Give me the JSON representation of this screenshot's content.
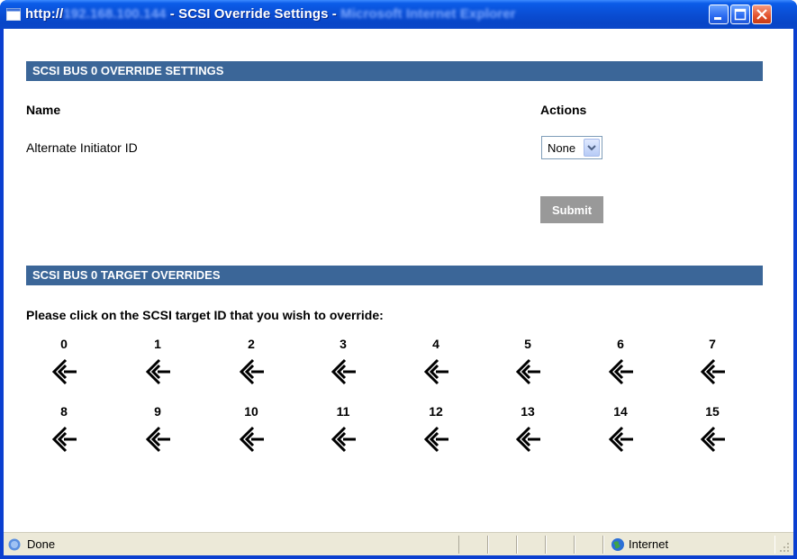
{
  "window": {
    "title_prefix": "http://",
    "title_host": "192.168.100.144",
    "title_middle": " - SCSI Override Settings - ",
    "title_browser": "Microsoft Internet Explorer"
  },
  "override_section": {
    "header": "SCSI BUS 0 OVERRIDE SETTINGS",
    "col_name": "Name",
    "col_actions": "Actions",
    "row_label": "Alternate Initiator ID",
    "select_value": "None",
    "submit_label": "Submit"
  },
  "targets_section": {
    "header": "SCSI BUS 0 TARGET OVERRIDES",
    "instruction": "Please click on the SCSI target ID that you wish to override:",
    "target_ids": [
      "0",
      "1",
      "2",
      "3",
      "4",
      "5",
      "6",
      "7",
      "8",
      "9",
      "10",
      "11",
      "12",
      "13",
      "14",
      "15"
    ],
    "icon": "scsi-connector-icon"
  },
  "statusbar": {
    "status_text": "Done",
    "zone_text": "Internet"
  },
  "colors": {
    "section_header_bg": "#3b6698",
    "submit_bg": "#999999"
  }
}
